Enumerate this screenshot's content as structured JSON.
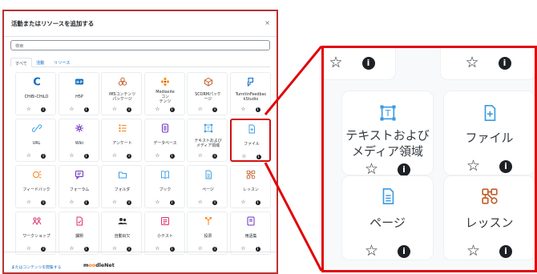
{
  "dialog": {
    "title": "活動またはリソースを追加する",
    "close": "×",
    "search_placeholder": "検索",
    "tabs": [
      {
        "label": "すべて"
      },
      {
        "label": "活動"
      },
      {
        "label": "リソース"
      }
    ],
    "footer_text": "またはコンテンツを閲覧する",
    "moodlenet_logo": {
      "prefix": "m",
      "o": "oo",
      "suffix": "dleNet"
    }
  },
  "star": "☆",
  "info": "i",
  "activities": [
    {
      "label": "CHiBi-CHiLO",
      "icon": "letter-c-icon",
      "color": "#0f6cbf"
    },
    {
      "label": "H5P",
      "icon": "h5p-icon",
      "color": "#0f6cbf"
    },
    {
      "label": "IMSコンテンツ パッケージ",
      "icon": "package-icon",
      "color": "#c25e2a"
    },
    {
      "label": "Mediasite コン テンツ",
      "icon": "dots-icon",
      "color": "#f7931e"
    },
    {
      "label": "SCORMパッケ ージ",
      "icon": "box-icon",
      "color": "#c25e2a"
    },
    {
      "label": "TurnitinFeedbac kStudio",
      "icon": "turnitin-icon",
      "color": "#0f6cbf"
    },
    {
      "label": "URL",
      "icon": "link-icon",
      "color": "#399be2"
    },
    {
      "label": "Wiki",
      "icon": "wiki-icon",
      "color": "#6c2fc1"
    },
    {
      "label": "アンケート",
      "icon": "survey-icon",
      "color": "#f98012"
    },
    {
      "label": "データベース",
      "icon": "database-icon",
      "color": "#6c2fc1"
    },
    {
      "label": "テキストおよび メディア領域",
      "icon": "text-media-icon",
      "color": "#399be2"
    },
    {
      "label": "ファイル",
      "icon": "file-icon",
      "color": "#399be2"
    },
    {
      "label": "フィードバック",
      "icon": "feedback-icon",
      "color": "#f98012"
    },
    {
      "label": "フォーラム",
      "icon": "forum-icon",
      "color": "#6c2fc1"
    },
    {
      "label": "フォルダ",
      "icon": "folder-icon",
      "color": "#399be2"
    },
    {
      "label": "ブック",
      "icon": "book-icon",
      "color": "#399be2"
    },
    {
      "label": "ページ",
      "icon": "page-icon",
      "color": "#399be2"
    },
    {
      "label": "レッスン",
      "icon": "lesson-icon",
      "color": "#c25e2a"
    },
    {
      "label": "ワークショップ",
      "icon": "workshop-icon",
      "color": "#e1306c"
    },
    {
      "label": "課題",
      "icon": "assignment-icon",
      "color": "#e1306c"
    },
    {
      "label": "自動出欠",
      "icon": "attendance-icon",
      "color": "#333333"
    },
    {
      "label": "小テスト",
      "icon": "quiz-icon",
      "color": "#e1306c"
    },
    {
      "label": "投票",
      "icon": "choice-icon",
      "color": "#f98012"
    },
    {
      "label": "用語集",
      "icon": "glossary-icon",
      "color": "#6c2fc1"
    }
  ],
  "zoom": {
    "cards": [
      {
        "label": "テキストおよび メディア領域",
        "icon": "text-media-icon",
        "color": "#399be2"
      },
      {
        "label": "ファイル",
        "icon": "file-icon",
        "color": "#399be2"
      },
      {
        "label": "ページ",
        "icon": "page-icon",
        "color": "#399be2"
      },
      {
        "label": "レッスン",
        "icon": "lesson-icon",
        "color": "#c25e2a"
      }
    ]
  },
  "accent": {
    "highlight": "#e0060a",
    "link": "#0f6cbf"
  }
}
